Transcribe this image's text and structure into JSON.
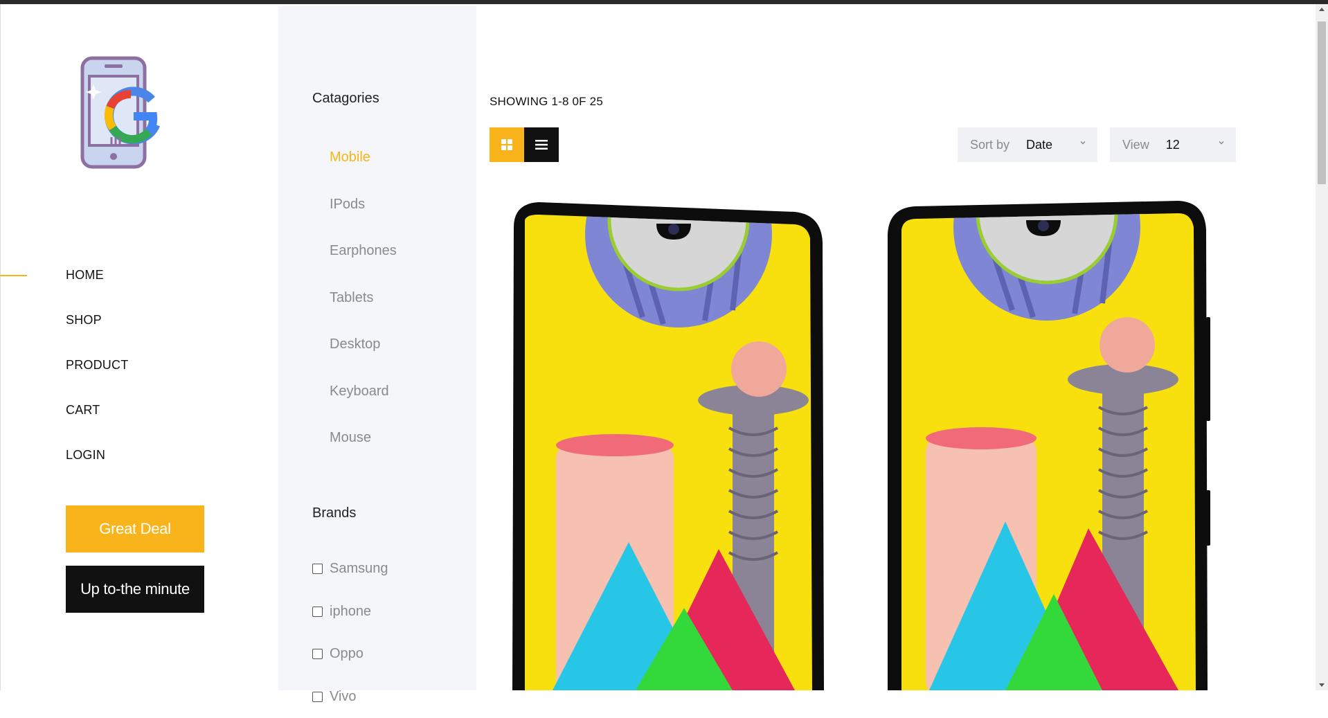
{
  "nav": {
    "items": [
      "HOME",
      "SHOP",
      "PRODUCT",
      "CART",
      "LOGIN"
    ],
    "active": "HOME"
  },
  "buttons": {
    "great_deal": "Great Deal",
    "up_to_minute": "Up to-the minute"
  },
  "sidebar": {
    "categories_title": "Catagories",
    "categories": [
      "Mobile",
      "IPods",
      "Earphones",
      "Tablets",
      "Desktop",
      "Keyboard",
      "Mouse"
    ],
    "active_category": "Mobile",
    "brands_title": "Brands",
    "brands": [
      "Samsung",
      "iphone",
      "Oppo",
      "Vivo"
    ]
  },
  "main": {
    "showing": "SHOWING 1-8 0F 25",
    "sort_label": "Sort by",
    "sort_value": "Date",
    "view_label": "View",
    "view_value": "12"
  },
  "colors": {
    "accent": "#f8b41a",
    "dark": "#111111",
    "sidebar_bg": "#f5f6f9"
  },
  "icons": {
    "logo": "phone-google-logo-icon",
    "grid": "grid-view-icon",
    "list": "list-view-icon",
    "chevron": "chevron-down-icon"
  }
}
